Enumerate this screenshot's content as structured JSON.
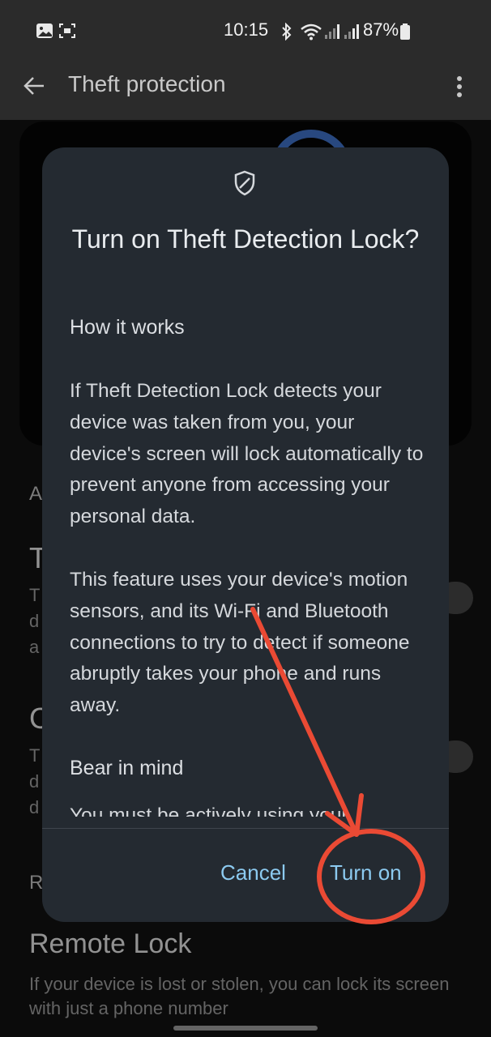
{
  "status_bar": {
    "time": "10:15",
    "battery": "87%",
    "icons": [
      "gallery-icon",
      "screenshot-icon",
      "bluetooth-icon",
      "wifi-icon",
      "signal-icon",
      "signal-icon",
      "battery-icon"
    ]
  },
  "app_bar": {
    "title": "Theft protection",
    "back_icon": "arrow-left-icon",
    "menu_icon": "more-vert-icon"
  },
  "background": {
    "section_letter_1": "A",
    "item_letter_1": "T",
    "item_desc_letters_1": [
      "T",
      "d",
      "a"
    ],
    "item_letter_2": "C",
    "item_desc_letters_2": [
      "T",
      "d",
      "d"
    ],
    "section_letter_2": "R",
    "remote_lock": {
      "title": "Remote Lock",
      "description": "If your device is lost or stolen, you can lock its screen with just a phone number"
    }
  },
  "dialog": {
    "icon": "shield-icon",
    "title": "Turn on Theft Detection Lock?",
    "section1_heading": "How it works",
    "paragraph1": "If Theft Detection Lock detects your device was taken from you, your device's screen will lock automatically to prevent anyone from accessing your personal data.",
    "paragraph2": "This feature uses your device's motion sensors, and its Wi-Fi and Bluetooth connections to try to detect if someone abruptly takes your phone and runs away.",
    "section2_heading": "Bear in mind",
    "partial_text": "You must be actively using your",
    "cancel_label": "Cancel",
    "confirm_label": "Turn on"
  },
  "colors": {
    "accent": "#8ccaf0",
    "annotation": "#ea4a34",
    "dialog_bg": "#242a31"
  }
}
